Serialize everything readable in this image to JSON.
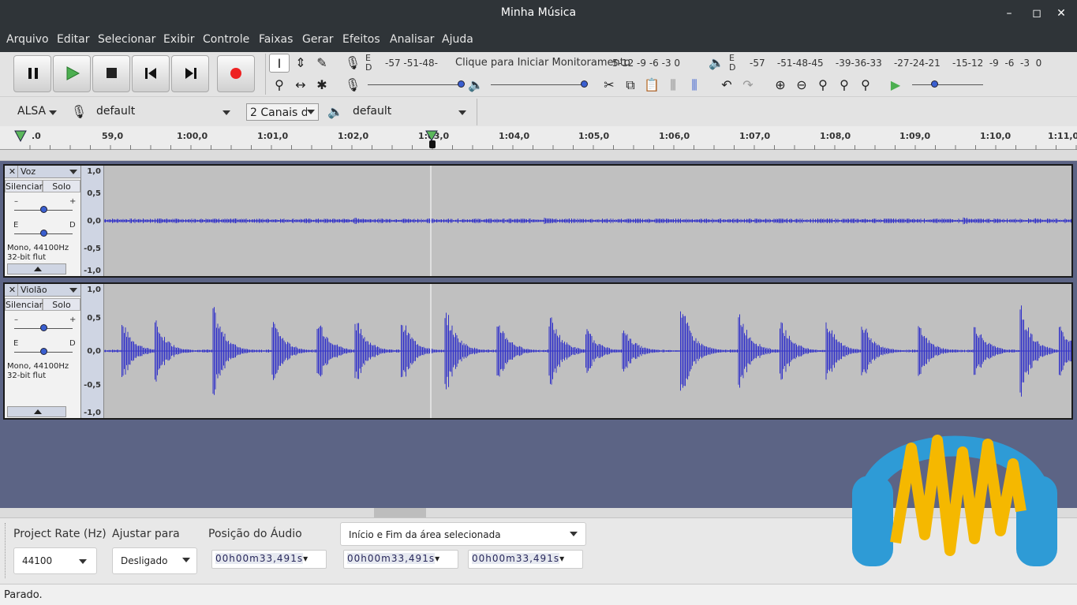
{
  "window": {
    "title": "Minha Música"
  },
  "menu": [
    "Arquivo",
    "Editar",
    "Selecionar",
    "Exibir",
    "Controle",
    "Faixas",
    "Gerar",
    "Efeitos",
    "Analisar",
    "Ajuda"
  ],
  "meters": {
    "rec_channels": "E\nD",
    "rec_scale": "-57   -51-48-",
    "rec_hint": "Clique para Iniciar Monitoramento",
    "rec_scale_end": "5-12  -9  -6  -3  0",
    "play_channels": "E\nD",
    "play_scale": "-57    -51-48-45    -39-36-33    -27-24-21    -15-12  -9  -6  -3  0"
  },
  "device": {
    "host": "ALSA",
    "rec_device": "default",
    "channels": "2 Canais de",
    "play_device": "default"
  },
  "ruler": {
    "labels": [
      ".0",
      "59,0",
      "1:00,0",
      "1:01,0",
      "1:02,0",
      "1:03,0",
      "1:04,0",
      "1:05,0",
      "1:06,0",
      "1:07,0",
      "1:08,0",
      "1:09,0",
      "1:10,0",
      "1:11,0"
    ]
  },
  "tracks": [
    {
      "name": "Voz",
      "mute": "Silenciar",
      "solo": "Solo",
      "gain_min": "–",
      "gain_max": "+",
      "pan_left": "E",
      "pan_right": "D",
      "format": "Mono, 44100Hz",
      "bit_depth": "32-bit flut",
      "gain": 0.5,
      "pan": 0.5,
      "scale": [
        "1,0",
        "0,5",
        "0,0",
        "-0,5",
        "-1,0"
      ]
    },
    {
      "name": "Violão",
      "mute": "Silenciar",
      "solo": "Solo",
      "gain_min": "–",
      "gain_max": "+",
      "pan_left": "E",
      "pan_right": "D",
      "format": "Mono, 44100Hz",
      "bit_depth": "32-bit flut",
      "gain": 0.5,
      "pan": 0.5,
      "scale": [
        "1,0",
        "0,5",
        "0,0",
        "-0,5",
        "-1,0"
      ]
    }
  ],
  "selection_toolbar": {
    "rate_label": "Project Rate (Hz)",
    "rate_value": "44100",
    "snap_label": "Ajustar para",
    "snap_value": "Desligado",
    "position_label": "Posição do Áudio",
    "range_mode": "Início e Fim da área selecionada",
    "position_time": "00h00m33,491s",
    "start_time": "00h00m33,491s",
    "end_time": "00h00m33,491s"
  },
  "status": "Parado.",
  "colors": {
    "waveform": "#3232c8",
    "track_bg": "#c0c0c0",
    "selection": "#cfd5e3",
    "logo_blue": "#2e9bd6",
    "logo_yellow": "#f5b800"
  },
  "icons": [
    "pause-icon",
    "play-icon",
    "stop-icon",
    "skip-start-icon",
    "skip-end-icon",
    "record-icon",
    "selection-tool-icon",
    "envelope-tool-icon",
    "draw-tool-icon",
    "zoom-tool-icon",
    "timeshift-tool-icon",
    "multi-tool-icon",
    "microphone-icon",
    "speaker-icon",
    "cut-icon",
    "copy-icon",
    "paste-icon",
    "trim-icon",
    "silence-icon",
    "undo-icon",
    "redo-icon",
    "zoom-in-icon",
    "zoom-out-icon",
    "fit-selection-icon",
    "fit-project-icon",
    "zoom-toggle-icon",
    "play-at-speed-icon"
  ]
}
